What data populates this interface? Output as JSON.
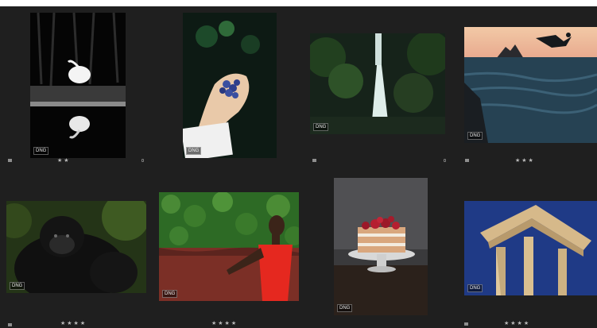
{
  "grid": {
    "accent_background": "#1f1f1f",
    "items": [
      {
        "title": "egret",
        "format": "DNG",
        "rating": 2,
        "rating_text": "★★"
      },
      {
        "title": "blueberries",
        "format": "DNG",
        "rating": 0,
        "rating_text": ""
      },
      {
        "title": "waterfall",
        "format": "DNG",
        "rating": 0,
        "rating_text": ""
      },
      {
        "title": "cliff jumper",
        "format": "DNG",
        "rating": 3,
        "rating_text": "★★★"
      },
      {
        "title": "gorilla",
        "format": "DNG",
        "rating": 4,
        "rating_text": "★★★★"
      },
      {
        "title": "woman in red",
        "format": "DNG",
        "rating": 4,
        "rating_text": "★★★★"
      },
      {
        "title": "berry cake",
        "format": "DNG",
        "rating": 0,
        "rating_text": ""
      },
      {
        "title": "temple columns",
        "format": "DNG",
        "rating": 4,
        "rating_text": "★★★★"
      }
    ]
  }
}
